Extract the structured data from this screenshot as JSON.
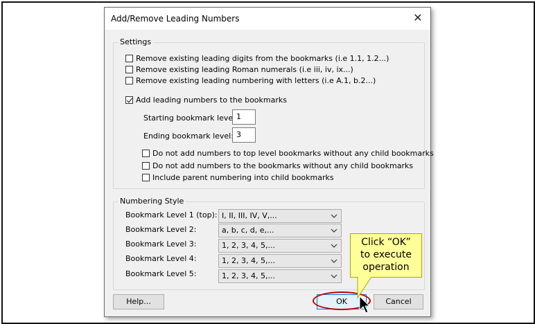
{
  "dialog": {
    "title": "Add/Remove Leading Numbers",
    "close_glyph": "✕"
  },
  "settings": {
    "group_label": "Settings",
    "options": [
      {
        "label": "Remove existing leading digits from the bookmarks (i.e 1.1, 1.2...)",
        "checked": false
      },
      {
        "label": "Remove existing leading Roman numerals (i.e iii, iv, ix...)",
        "checked": false
      },
      {
        "label": "Remove existing leading numbering with letters (i.e A.1, b.2...)",
        "checked": false
      }
    ],
    "add_numbers": {
      "label": "Add leading numbers to the bookmarks",
      "checked": true
    },
    "starting_level": {
      "label": "Starting bookmark level:",
      "value": "1"
    },
    "ending_level": {
      "label": "Ending bookmark level:",
      "value": "3"
    },
    "sub_options": [
      {
        "label": "Do not add numbers to top level bookmarks without any child bookmarks",
        "checked": false
      },
      {
        "label": "Do not add numbers to the bookmarks without any child bookmarks",
        "checked": false
      },
      {
        "label": "Include parent numbering into child bookmarks",
        "checked": false
      }
    ]
  },
  "numbering_style": {
    "group_label": "Numbering Style",
    "levels": [
      {
        "label": "Bookmark Level 1 (top):",
        "value": "I, II, III, IV, V,..."
      },
      {
        "label": "Bookmark Level 2:",
        "value": "a, b, c, d, e,..."
      },
      {
        "label": "Bookmark Level 3:",
        "value": "1, 2, 3, 4, 5,..."
      },
      {
        "label": "Bookmark Level 4:",
        "value": "1, 2, 3, 4, 5,..."
      },
      {
        "label": "Bookmark Level 5:",
        "value": "1, 2, 3, 4, 5,..."
      }
    ]
  },
  "buttons": {
    "help": "Help...",
    "ok": "OK",
    "cancel": "Cancel"
  },
  "callout": {
    "line1": "Click “OK”",
    "line2": "to execute",
    "line3": "operation"
  },
  "icons": {
    "close": "close-icon",
    "dropdown": "chevron-down-icon",
    "cursor": "mouse-pointer-icon"
  },
  "colors": {
    "highlight_oval": "#c00000",
    "callout_fill": "#ffff99",
    "default_button_border": "#0078d7"
  }
}
